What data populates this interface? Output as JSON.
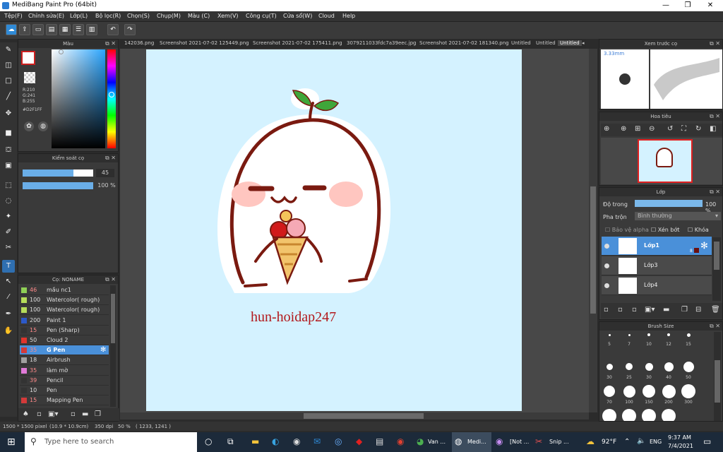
{
  "window": {
    "title": "MediBang Paint Pro (64bit)",
    "minimize": "—",
    "maximize": "❐",
    "close": "✕"
  },
  "menu": [
    "Tệp(F)",
    "Chỉnh sửa(E)",
    "Lớp(L)",
    "Bộ lọc(R)",
    "Chọn(S)",
    "Chụp(M)",
    "Màu (C)",
    "Xem(V)",
    "Công cụ(T)",
    "Cửa sổ(W)",
    "Cloud",
    "Help"
  ],
  "tabs": [
    "142036.png",
    "Screenshot 2021-07-02 125449.png",
    "Screenshot 2021-07-02 175411.png",
    "3079211033fdc7a39eec.jpg",
    "Screenshot 2021-07-02 181340.png",
    "Untitled",
    "Untitled",
    "Untitled"
  ],
  "color_panel": {
    "title": "Màu",
    "r": "R:210",
    "g": "G:241",
    "b": "B:255",
    "hex": "#D2F1FF",
    "current_color": "#D2F1FF",
    "fg_color": "#cc1f1f"
  },
  "brush_control": {
    "title": "Kiểm soát cọ",
    "size": "45",
    "opacity": "100 %",
    "size_fraction": 0.72,
    "opacity_fraction": 1.0
  },
  "brush_list": {
    "title": "Cọ: NONAME",
    "items": [
      {
        "size": "46",
        "name": "mầu nc1",
        "color": "#8fcf56"
      },
      {
        "size": "100",
        "name": "Watercolor( rough)",
        "color": "#b6dd5a"
      },
      {
        "size": "100",
        "name": "Watercolor( rough)",
        "color": "#b6dd5a"
      },
      {
        "size": "200",
        "name": "Paint 1",
        "color": "#2c59c9"
      },
      {
        "size": "15",
        "name": "Pen (Sharp)",
        "color": "#333333"
      },
      {
        "size": "50",
        "name": "Cloud 2",
        "color": "#e0342c"
      },
      {
        "size": "35",
        "name": "G Pen",
        "color": "#d23a3a"
      },
      {
        "size": "18",
        "name": "Airbrush",
        "color": "#a0a0a0"
      },
      {
        "size": "35",
        "name": "làm mờ",
        "color": "#e07ad8"
      },
      {
        "size": "39",
        "name": "Pencil",
        "color": "#333333"
      },
      {
        "size": "10",
        "name": "Pen",
        "color": "#333333"
      },
      {
        "size": "15",
        "name": "Mapping Pen",
        "color": "#d23a3a"
      }
    ],
    "selected_index": 6
  },
  "preview": {
    "title": "Xem trước cọ",
    "size": "3.33mm"
  },
  "navigator": {
    "title": "Hoa tiêu"
  },
  "layers": {
    "title": "Lớp",
    "opacity_label": "Độ trong",
    "opacity_value": "100 %",
    "blend_label": "Pha trộn",
    "blend_value": "Bình thường",
    "protect_alpha": "Bảo vệ alpha",
    "clipping": "Xén bớt",
    "lock": "Khóa",
    "items": [
      {
        "name": "Lớp1",
        "badge": "8"
      },
      {
        "name": "Lớp3"
      },
      {
        "name": "Lớp4"
      }
    ]
  },
  "brush_size": {
    "title": "Brush Size",
    "sizes": [
      "5",
      "7",
      "10",
      "12",
      "15",
      "30",
      "25",
      "30",
      "40",
      "50",
      "70",
      "100",
      "150",
      "200",
      "300",
      "400",
      "500",
      "700",
      "1000"
    ]
  },
  "canvas": {
    "watermark": "hun-hoidap247",
    "background": "#d4f2ff"
  },
  "status": {
    "size": "1500 * 1500 pixel",
    "cm": "(10.9 * 10.9cm)",
    "dpi": "350 dpi",
    "zoom": "50 %",
    "coords": "( 1233, 1241 )"
  },
  "taskbar": {
    "search_placeholder": "Type here to search",
    "apps": [
      "Van ...",
      "Medi...",
      "[Not ...",
      "Snip ..."
    ],
    "weather": "92°F",
    "lang": "ENG",
    "time": "9:37 AM",
    "date": "7/4/2021"
  }
}
